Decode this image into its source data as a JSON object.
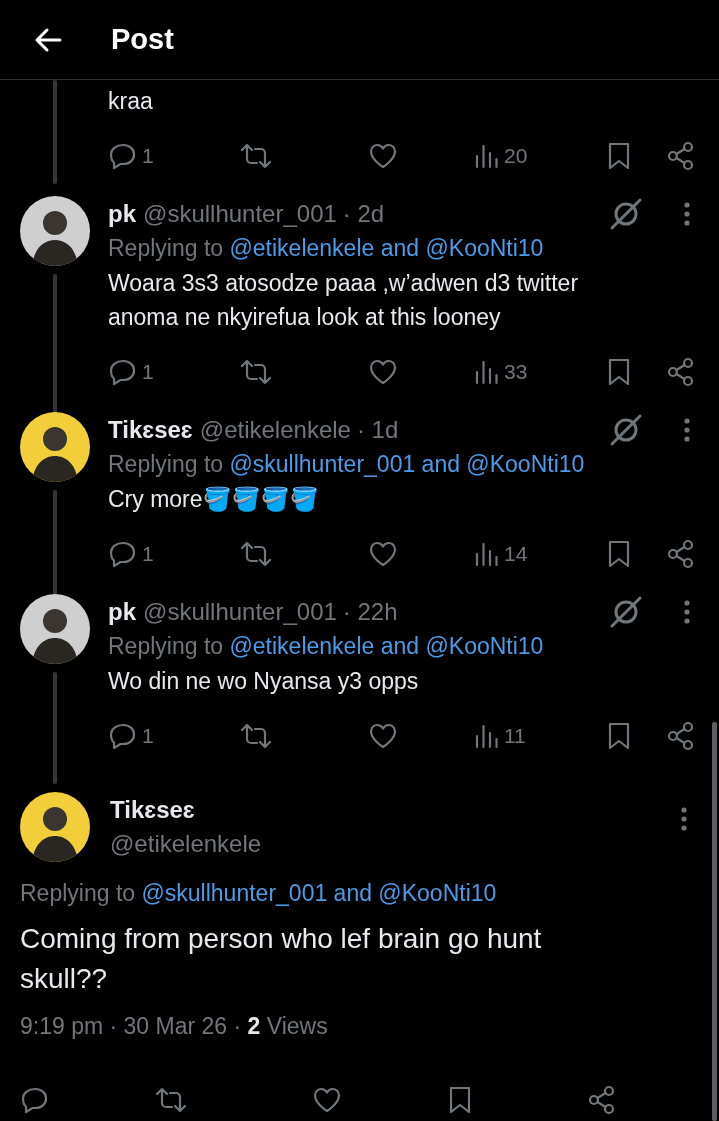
{
  "header": {
    "title": "Post"
  },
  "previous_post": {
    "text": "kraa",
    "stats": {
      "replies": "1",
      "views": "20"
    }
  },
  "replies": [
    {
      "name": "pk",
      "handle": "@skullhunter_001",
      "time": "· 2d",
      "color": "#cfcfcf",
      "replying_prefix": "Replying to",
      "replying_to": "@etikelenkele and @KooNti10",
      "text": "Woara 3s3 atosodze paaa ,w’adwen d3 twitter anoma ne nkyirefua look at this looney",
      "stats": {
        "replies": "1",
        "views": "33"
      }
    },
    {
      "name": "Tikɛseɛ",
      "handle": "@etikelenkele",
      "time": "· 1d",
      "color": "#f2cf3a",
      "replying_prefix": "Replying to",
      "replying_to": "@skullhunter_001 and @KooNti10",
      "text": "Cry more🪣🪣🪣🪣",
      "stats": {
        "replies": "1",
        "views": "14"
      }
    },
    {
      "name": "pk",
      "handle": "@skullhunter_001",
      "time": "· 22h",
      "color": "#cfcfcf",
      "replying_prefix": "Replying to",
      "replying_to": "@etikelenkele and @KooNti10",
      "text": "Wo din ne wo Nyansa y3 opps",
      "stats": {
        "replies": "1",
        "views": "11"
      }
    }
  ],
  "main_post": {
    "name": "Tikɛseɛ",
    "handle": "@etikelenkele",
    "color": "#f2cf3a",
    "replying_prefix": "Replying to",
    "replying_to": "@skullhunter_001 and @KooNti10",
    "text": "Coming from person who lef brain go hunt skull??",
    "meta": "9:19 pm · 30 Mar 26 · **2** Views"
  }
}
